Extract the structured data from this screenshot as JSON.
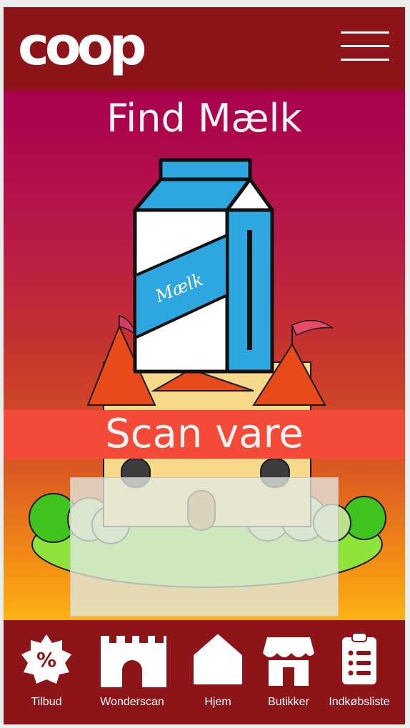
{
  "header": {
    "logo_text": "coop",
    "menu_icon": "hamburger-menu-icon"
  },
  "main": {
    "title": "Find Mælk",
    "carton_label": "Mælk",
    "scan_label": "Scan vare"
  },
  "nav": {
    "items": [
      {
        "label": "Tilbud",
        "icon": "percent-badge-icon"
      },
      {
        "label": "Wonderscan",
        "icon": "castle-icon"
      },
      {
        "label": "Hjem",
        "icon": "home-icon"
      },
      {
        "label": "Butikker",
        "icon": "store-icon"
      },
      {
        "label": "Indkøbsliste",
        "icon": "clipboard-list-icon"
      }
    ]
  },
  "colors": {
    "header_bg": "#8d1418",
    "gradient_top": "#a8004e",
    "gradient_bottom": "#fbb315",
    "scan_banner": "#f44a37",
    "carton_blue": "#2ea6e0"
  }
}
